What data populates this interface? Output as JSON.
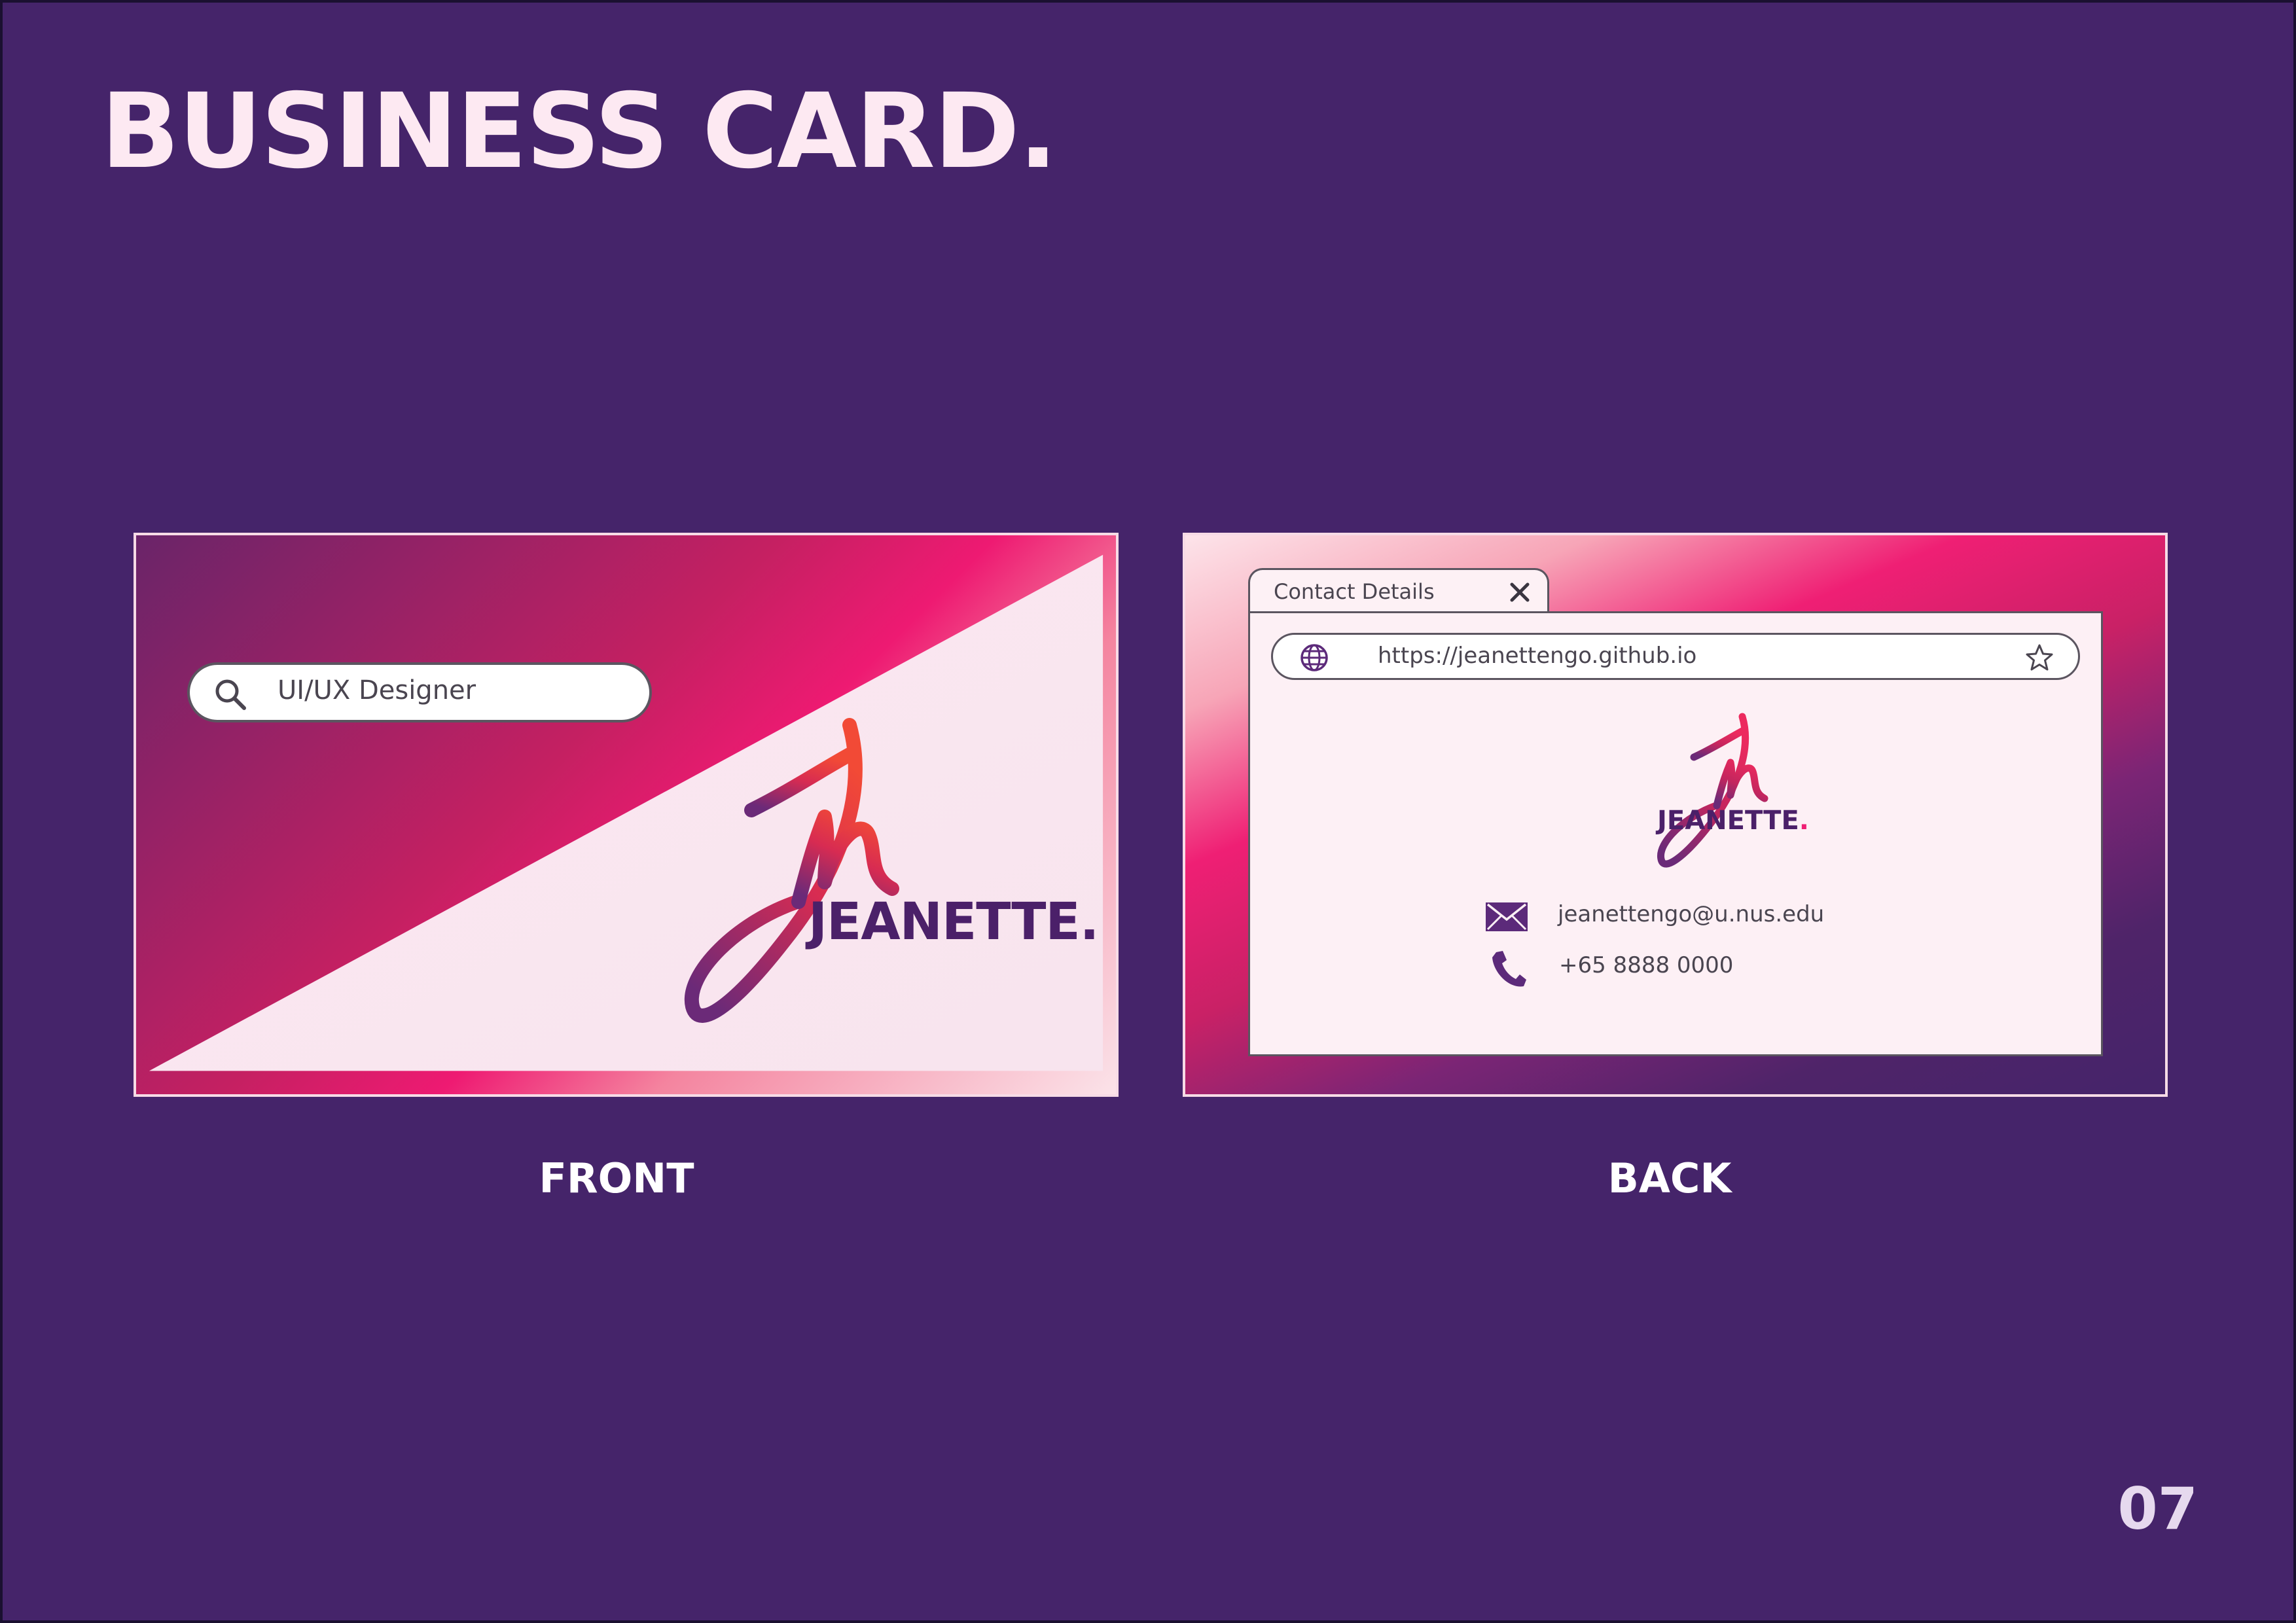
{
  "title": "BUSINESS CARD.",
  "page_number": "07",
  "front": {
    "caption": "FRONT",
    "search_text": "UI/UX Designer",
    "name": "JEANETTE.",
    "search_icon": "search-icon"
  },
  "back": {
    "caption": "BACK",
    "tab_label": "Contact Details",
    "url": "https://jeanettengo.github.io",
    "name": "JEANETTE",
    "name_dot": ".",
    "email": "jeanettengo@u.nus.edu",
    "phone": "+65 8888 0000",
    "icons": [
      "close-icon",
      "globe-icon",
      "star-icon",
      "mail-icon",
      "phone-icon"
    ]
  },
  "colors": {
    "background": "#45246a",
    "title": "#fde9f2",
    "accent_pink": "#ef1f74",
    "accent_orange": "#f04a3a",
    "deep_purple": "#4b2069",
    "card_light": "#fbe7f0"
  }
}
